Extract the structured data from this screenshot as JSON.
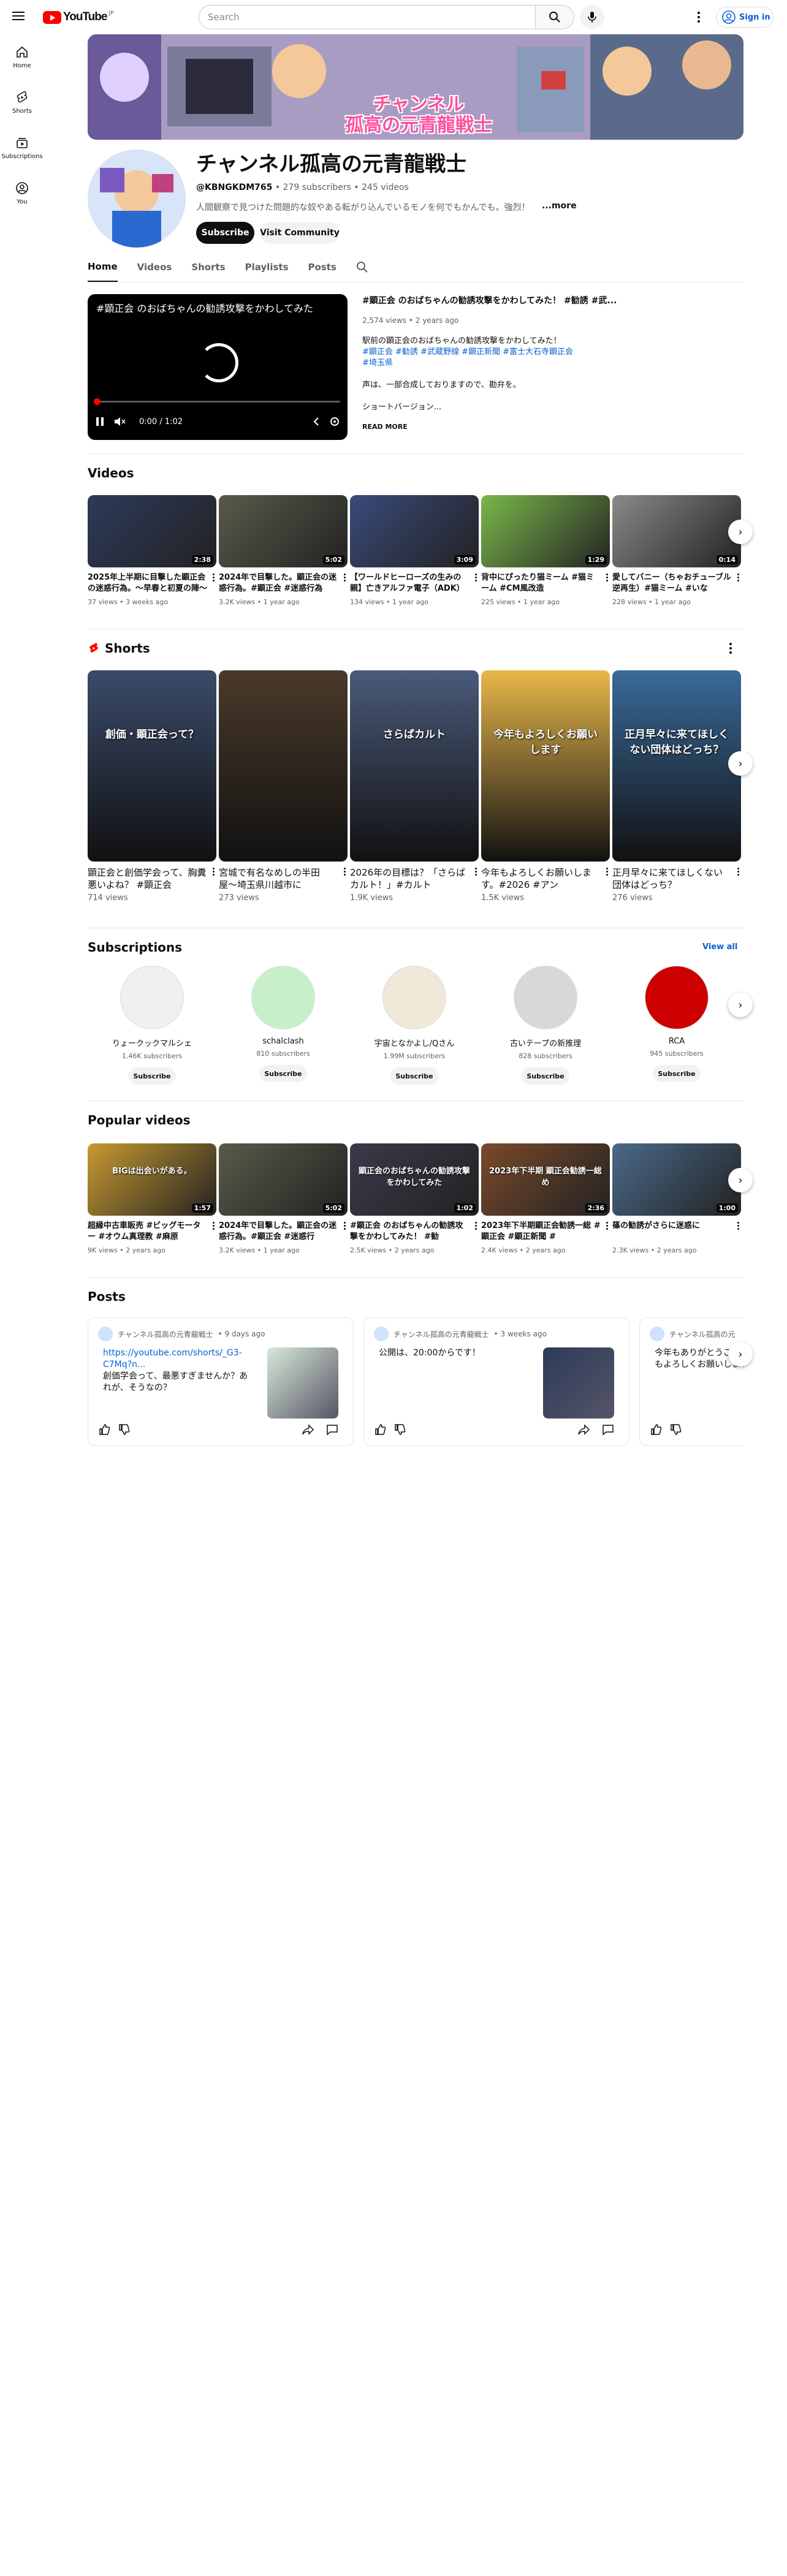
{
  "header": {
    "logo_text": "YouTube",
    "logo_sup": "JP",
    "search_placeholder": "Search",
    "signin_label": "Sign in"
  },
  "sidenav": [
    {
      "label": "Home",
      "icon": "home-icon"
    },
    {
      "label": "Shorts",
      "icon": "shorts-icon"
    },
    {
      "label": "Subscriptions",
      "icon": "subscriptions-icon"
    },
    {
      "label": "You",
      "icon": "you-icon"
    }
  ],
  "banner": {
    "text_line1": "チャンネル",
    "text_line2": "孤高の元青龍戦士"
  },
  "channel": {
    "name": "チャンネル孤高の元青龍戦士",
    "handle": "@KBNGKDM765",
    "subscribers": "279 subscribers",
    "videos": "245 videos",
    "description": "人間観察で見つけた問題的な奴やある転がり込んでいるモノを何でもかんでも。強烈！",
    "more_label": "...more",
    "subscribe_label": "Subscribe",
    "community_label": "Visit Community"
  },
  "tabs": [
    "Home",
    "Videos",
    "Shorts",
    "Playlists",
    "Posts"
  ],
  "featured": {
    "overlay_title": "#顕正会 のおばちゃんの勧誘攻撃をかわしてみた",
    "time": "0:00 / 1:02",
    "title": "#顕正会 のおばちゃんの勧誘攻撃をかわしてみた！ #勧誘 #武...",
    "stats": "2,574 views • 2 years ago",
    "desc_line1": "駅前の顕正会のおばちゃんの勧誘攻撃をかわしてみた！",
    "tags_line1": "#顕正会 #勧誘 #武蔵野線 #顕正新聞 #富士大石寺顕正会",
    "tags_line2": "#埼玉県",
    "desc_line2": "声は、一部合成しておりますので、勘弁を。",
    "desc_line3": "ショートバージョン...",
    "read_more": "READ MORE"
  },
  "sections": {
    "videos": "Videos",
    "shorts": "Shorts",
    "subscriptions": "Subscriptions",
    "view_all": "View all",
    "popular": "Popular videos",
    "posts": "Posts"
  },
  "videos": [
    {
      "title": "2025年上半期に目撃した顕正会の迷惑行為。〜早春と初夏の陣〜 #顕正会",
      "meta": "37 views • 3 weeks ago",
      "duration": "2:38",
      "color": "#2d3a5a"
    },
    {
      "title": "2024年で目撃した。顕正会の迷惑行為。#顕正会 #迷惑行為",
      "meta": "3.2K views • 1 year ago",
      "duration": "5:02",
      "color": "#5a5a4a"
    },
    {
      "title": "【ワールドヒーローズの生みの親】亡きアルファ電子（ADK）",
      "meta": "134 views • 1 year ago",
      "duration": "3:09",
      "color": "#3a4a7a"
    },
    {
      "title": "背中にぴったり猫ミーム #猫ミーム #CM風改造",
      "meta": "225 views • 1 year ago",
      "duration": "1:29",
      "color": "#7ab84a"
    },
    {
      "title": "愛してバニー（ちゃおチューブル逆再生）#猫ミーム #いな",
      "meta": "228 views • 1 year ago",
      "duration": "0:14",
      "color": "#8a8a8a"
    }
  ],
  "shorts": [
    {
      "title": "顕正会と創価学会って、胸糞悪いよね？ #顕正会",
      "meta": "714 views",
      "caption": "創価・顕正会って？",
      "color": "#3a4a6a"
    },
    {
      "title": "宮城で有名なめしの半田屋〜埼玉県川越市に",
      "meta": "273 views",
      "caption": "",
      "color": "#4a3a2a"
    },
    {
      "title": "2026年の目標は？「さらばカルト！」#カルト",
      "meta": "1.9K views",
      "caption": "さらばカルト",
      "color": "#4a5a7a"
    },
    {
      "title": "今年もよろしくお願いします。#2026 #アン",
      "meta": "1.5K views",
      "caption": "今年もよろしくお願いします",
      "color": "#e8b84a"
    },
    {
      "title": "正月早々に来てほしくない団体はどっち？",
      "meta": "276 views",
      "caption": "正月早々に来てほしくない団体はどっち？",
      "color": "#3a6a9a"
    }
  ],
  "subscriptions": [
    {
      "name": "りょークックマルシェ",
      "count": "1.46K subscribers",
      "subscribe": "Subscribe",
      "color": "#f0f0f0"
    },
    {
      "name": "schalclash",
      "count": "810 subscribers",
      "subscribe": "Subscribe",
      "color": "#c8f0c8"
    },
    {
      "name": "宇宙となかよし/Qさん",
      "count": "1.99M subscribers",
      "subscribe": "Subscribe",
      "color": "#f0e8d8"
    },
    {
      "name": "古いテープの新推理",
      "count": "828 subscribers",
      "subscribe": "Subscribe",
      "color": "#d8d8d8"
    },
    {
      "name": "RCA",
      "count": "945 subscribers",
      "subscribe": "Subscribe",
      "color": "#cc0000"
    }
  ],
  "popular": [
    {
      "title": "超縁中古車販売 #ビッグモーター #オウム真理教 #麻原",
      "meta": "9K views • 2 years ago",
      "duration": "1:57",
      "caption": "BIGは出会いがある。",
      "color": "#c89a30"
    },
    {
      "title": "2024年で目撃した。顕正会の迷惑行為。#顕正会 #迷惑行",
      "meta": "3.2K views • 1 year ago",
      "duration": "5:02",
      "caption": "",
      "color": "#5a5a4a"
    },
    {
      "title": "#顕正会 のおばちゃんの勧誘攻撃をかわしてみた！ #勧",
      "meta": "2.5K views • 2 years ago",
      "duration": "1:02",
      "caption": "顕正会のおばちゃんの勧誘攻撃をかわしてみた",
      "color": "#3a3a4a"
    },
    {
      "title": "2023年下半期顕正会勧誘一総 #顕正会 #顕正新聞 #",
      "meta": "2.4K views • 2 years ago",
      "duration": "2:36",
      "caption": "2023年下半期 顕正会勧誘一総め",
      "color": "#7a4a2a"
    },
    {
      "title": "篠の勧誘がさらに迷惑に",
      "meta": "2.3K views • 2 years ago",
      "duration": "1:00",
      "caption": "",
      "color": "#4a6a8a"
    }
  ],
  "posts": [
    {
      "author": "チャンネル孤高の元青龍戦士",
      "time": "• 9 days ago",
      "link": "https://youtube.com/shorts/_G3-C7Mq?n...",
      "text": "創価学会って、最悪すぎませんか？あれが、そうなの？",
      "color": "#d8e8d8"
    },
    {
      "author": "チャンネル孤高の元青龍戦士",
      "time": "• 3 weeks ago",
      "link": "",
      "text": "公開は、20:00からです！",
      "color": "#2d3a5a"
    },
    {
      "author": "チャンネル孤高の元",
      "time": "",
      "link": "",
      "text": "今年もありがとうございました。来年もよろしくお願いします",
      "color": "#ffffff"
    }
  ]
}
